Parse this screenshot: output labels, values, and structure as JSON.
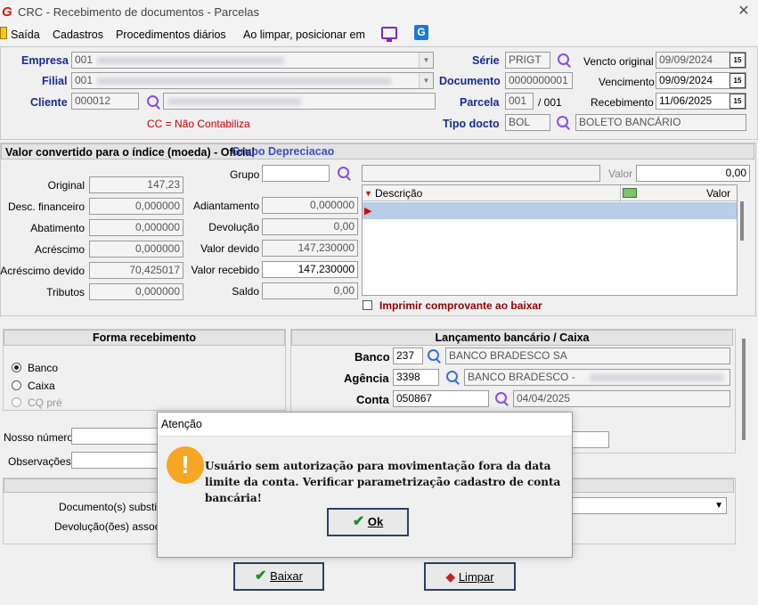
{
  "window": {
    "title": "CRC - Recebimento de documentos - Parcelas"
  },
  "menu": {
    "items": [
      "Saída",
      "Cadastros",
      "Procedimentos diários",
      "Ao limpar, posicionar em"
    ]
  },
  "header": {
    "empresa_label": "Empresa",
    "empresa_value": "001",
    "filial_label": "Filial",
    "filial_value": "001",
    "cliente_label": "Cliente",
    "cliente_value": "000012",
    "cc_note": "CC = Não Contabiliza",
    "serie_label": "Série",
    "serie_value": "PRIGT",
    "documento_label": "Documento",
    "documento_value": "0000000001",
    "parcela_label": "Parcela",
    "parcela_value": "001",
    "parcela_total": "/ 001",
    "tipo_label": "Tipo docto",
    "tipo_value": "BOL",
    "tipo_desc": "BOLETO BANCÁRIO",
    "vencto_original_label": "Vencto original",
    "vencto_original_value": "09/09/2024",
    "vencimento_label": "Vencimento",
    "vencimento_value": "09/09/2024",
    "recebimento_label": "Recebimento",
    "recebimento_value": "11/06/2025",
    "calendar_text": "15"
  },
  "valores": {
    "section_title": "Valor convertido para o índice (moeda) - Oficial",
    "section_overlay": "Grupo Depreciacao",
    "rows_left": [
      {
        "label": "Original",
        "value": "147,23"
      },
      {
        "label": "Desc. financeiro",
        "value": "0,000000"
      },
      {
        "label": "Abatimento",
        "value": "0,000000"
      },
      {
        "label": "Acréscimo",
        "value": "0,000000"
      },
      {
        "label": "Acréscimo devido",
        "value": "70,425017"
      },
      {
        "label": "Tributos",
        "value": "0,000000"
      }
    ],
    "rows_mid": [
      {
        "label": "Adiantamento",
        "value": "0,000000"
      },
      {
        "label": "Devolução",
        "value": "0,00"
      },
      {
        "label": "Valor devido",
        "value": "147,230000"
      },
      {
        "label": "Valor recebido",
        "value": "147,230000"
      },
      {
        "label": "Saldo",
        "value": "0,00"
      }
    ],
    "grupo_label": "Grupo",
    "valor_label": "Valor",
    "valor_value": "0,00",
    "grid_cols": [
      "Descrição",
      "Valor"
    ],
    "imprimir_label": "Imprimir comprovante ao baixar"
  },
  "forma": {
    "title": "Forma recebimento",
    "options": [
      "Banco",
      "Caixa",
      "CQ pré"
    ],
    "selected": "Banco"
  },
  "lancamento": {
    "title": "Lançamento bancário / Caixa",
    "banco_label": "Banco",
    "banco_value": "237",
    "banco_desc": "BANCO BRADESCO SA",
    "agencia_label": "Agência",
    "agencia_value": "3398",
    "agencia_desc": "BANCO BRADESCO -",
    "conta_label": "Conta",
    "conta_value": "050867",
    "conta_date": "04/04/2025"
  },
  "lower": {
    "nosso_numero_label": "Nosso número",
    "observacoes_label": "Observações",
    "doc_subst_label": "Documento(s) substitu",
    "devolucoes_label": "Devolução(ões) assoc"
  },
  "buttons": {
    "baixar": "Baixar",
    "limpar": "Limpar"
  },
  "dialog": {
    "title": "Atenção",
    "message": "Usuário sem autorização para movimentação fora da data limite da conta. Verificar parametrização cadastro de conta bancária!",
    "ok": "Ok"
  },
  "colors": {
    "label_blue": "#1b2a8a",
    "note_red": "#c00000",
    "warning": "#f5a623",
    "ok_check": "#1c8c2c"
  }
}
